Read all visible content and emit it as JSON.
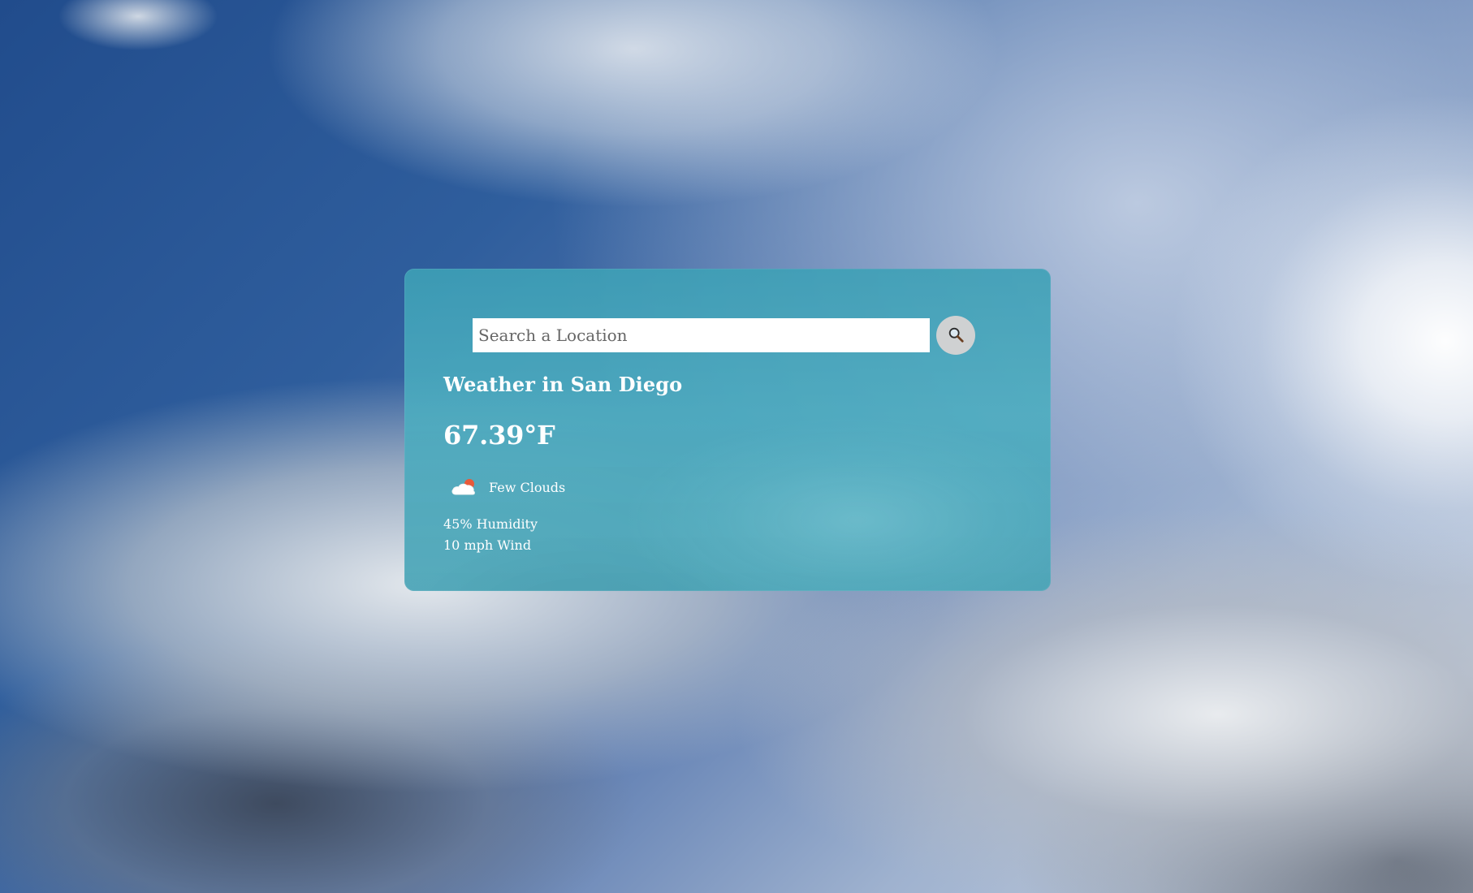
{
  "search": {
    "placeholder": "Search a Location",
    "button_icon": "search-icon"
  },
  "weather": {
    "title": "Weather in San Diego",
    "temperature": "67.39°F",
    "condition_icon": "few-clouds-icon",
    "condition_text": "Few Clouds",
    "humidity": "45% Humidity",
    "wind": "10 mph Wind"
  },
  "theme": {
    "card_color": "#4aa7bd",
    "text_color": "#ffffff",
    "search_button_color": "#d2d2d2",
    "sun_accent": "#e85a3a"
  }
}
